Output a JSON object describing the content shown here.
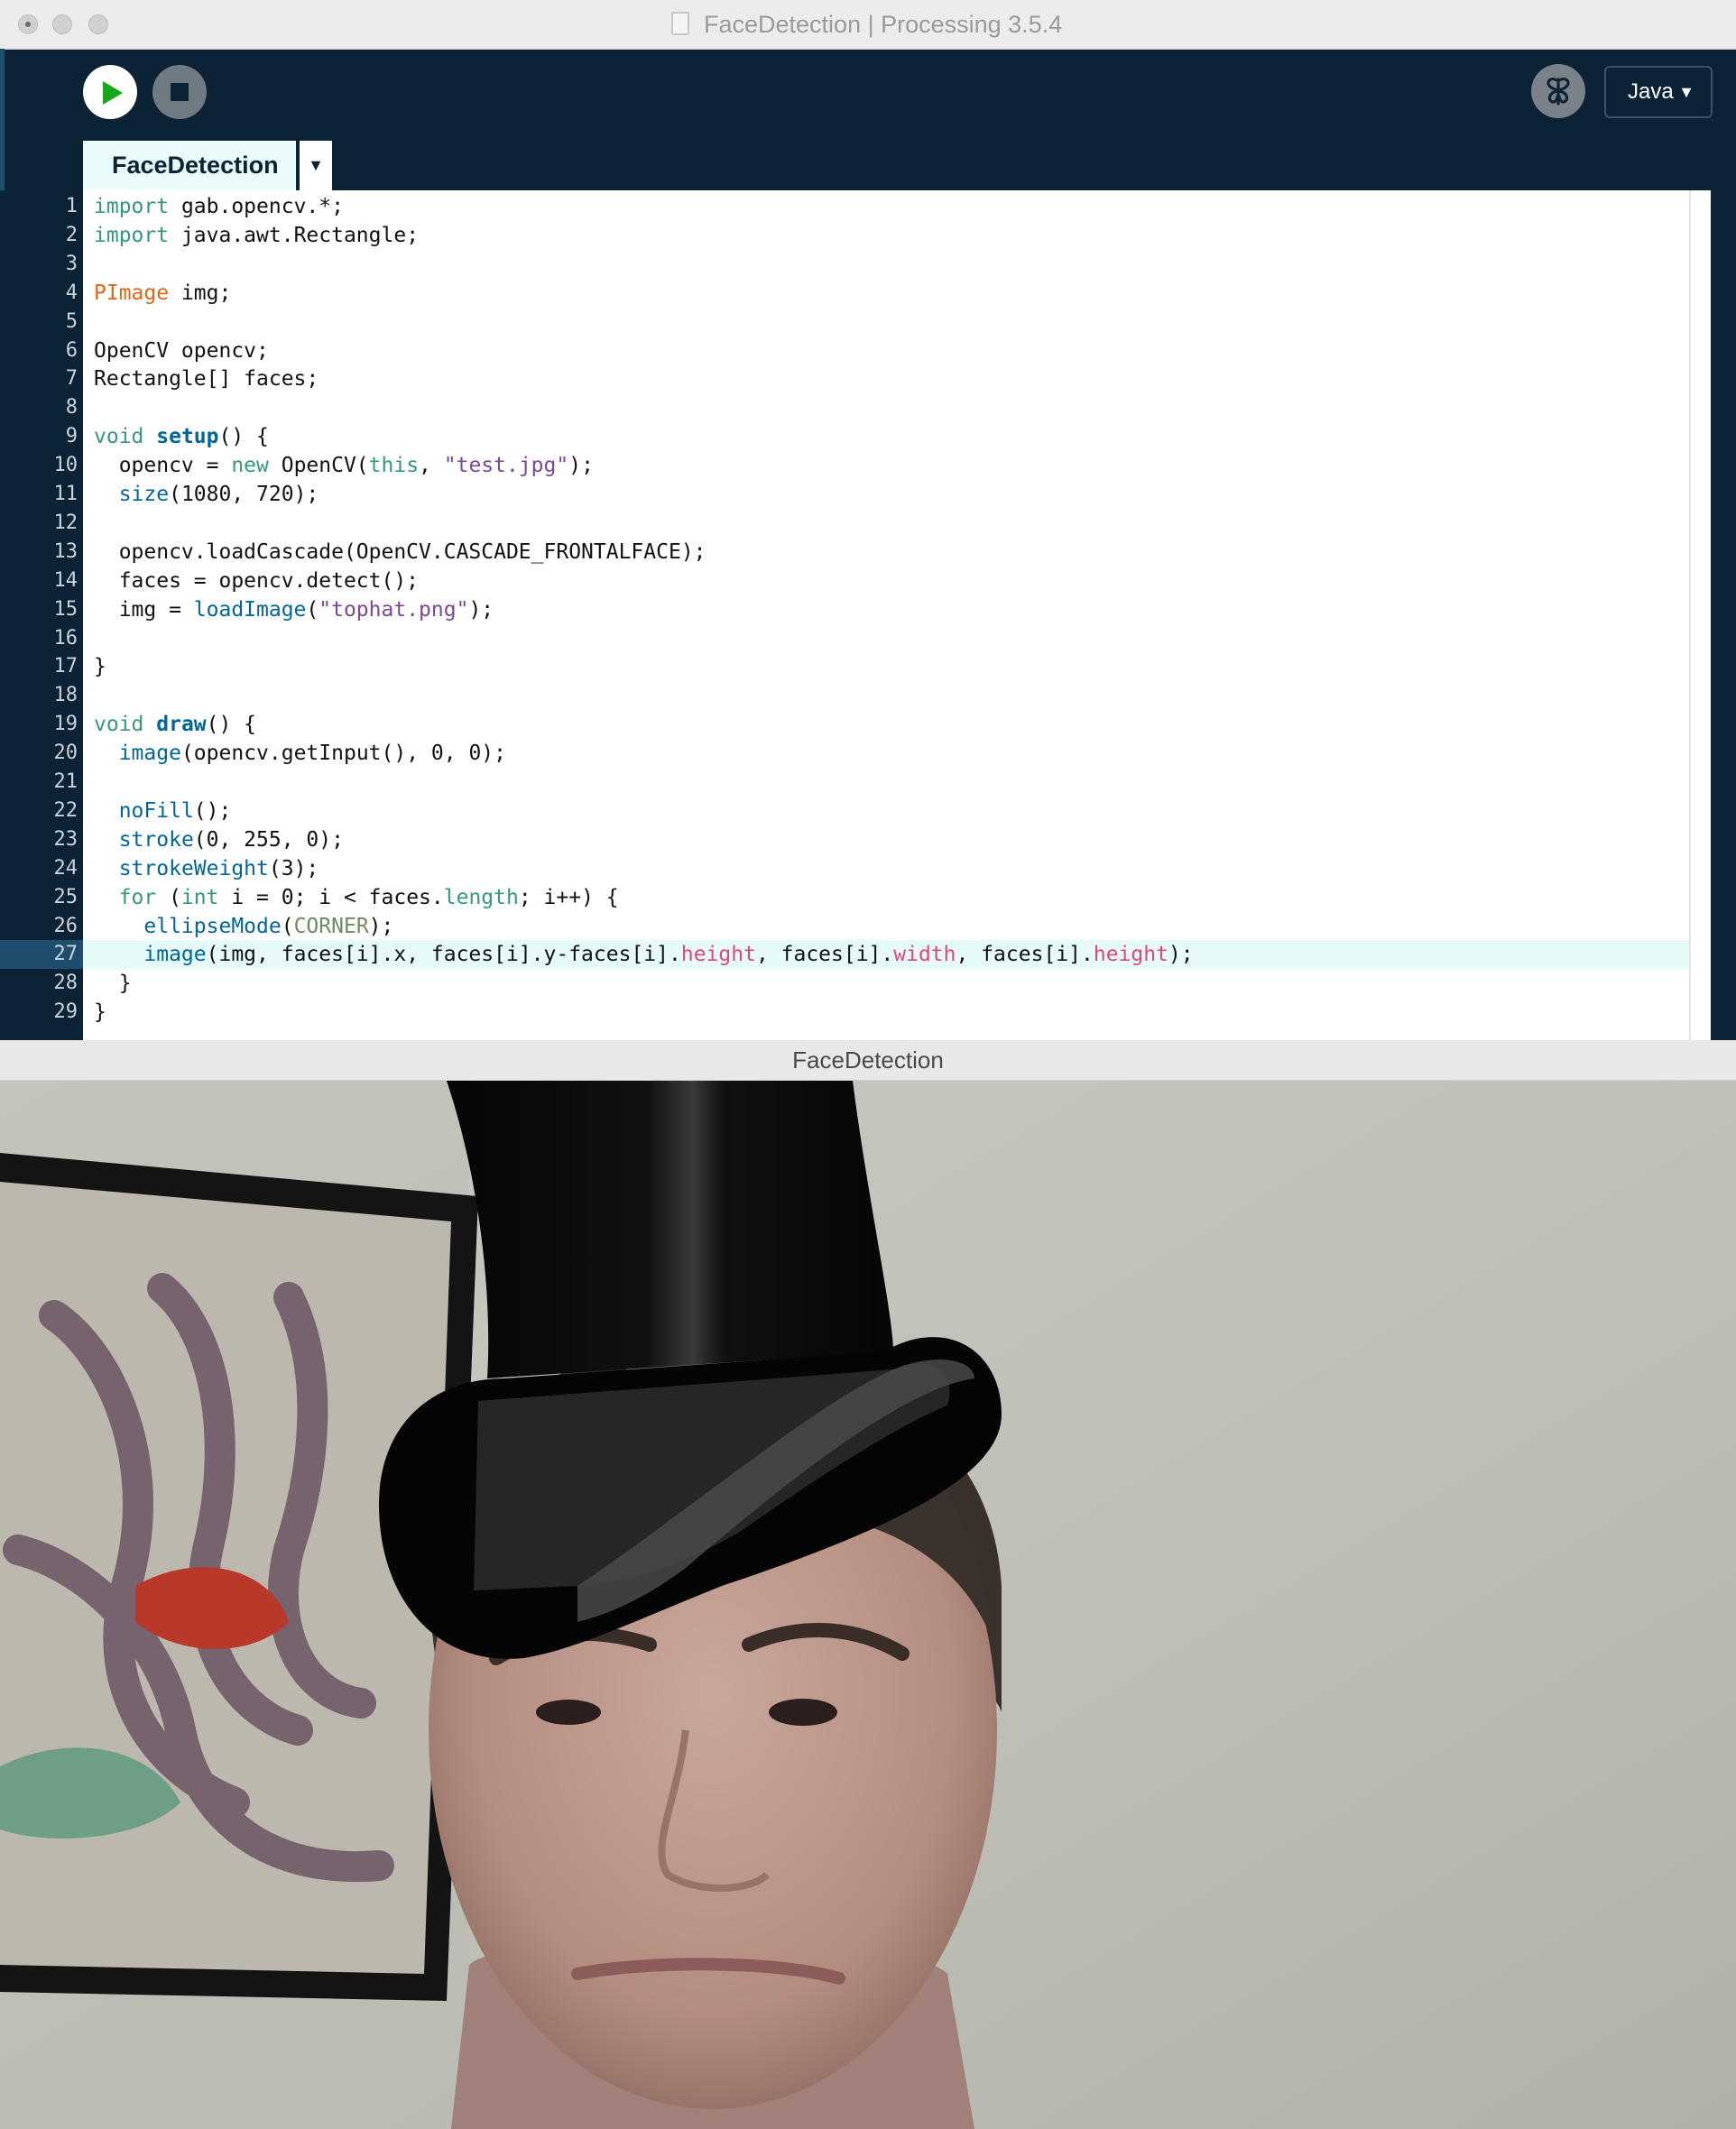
{
  "window": {
    "title": "FaceDetection | Processing 3.5.4"
  },
  "toolbar": {
    "run_icon": "play-icon",
    "stop_icon": "stop-icon",
    "debug_icon": "butterfly-icon",
    "mode_label": "Java",
    "mode_caret": "▼"
  },
  "tabs": [
    {
      "label": "FaceDetection"
    }
  ],
  "tab_menu_caret": "▼",
  "editor": {
    "current_line": 27,
    "line_numbers": [
      "1",
      "2",
      "3",
      "4",
      "5",
      "6",
      "7",
      "8",
      "9",
      "10",
      "11",
      "12",
      "13",
      "14",
      "15",
      "16",
      "17",
      "18",
      "19",
      "20",
      "21",
      "22",
      "23",
      "24",
      "25",
      "26",
      "27",
      "28",
      "29"
    ],
    "lines": [
      "import gab.opencv.*;",
      "import java.awt.Rectangle;",
      "",
      "PImage img;",
      "",
      "OpenCV opencv;",
      "Rectangle[] faces;",
      "",
      "void setup() {",
      "  opencv = new OpenCV(this, \"test.jpg\");",
      "  size(1080, 720);",
      "",
      "  opencv.loadCascade(OpenCV.CASCADE_FRONTALFACE);",
      "  faces = opencv.detect();",
      "  img = loadImage(\"tophat.png\");",
      "",
      "}",
      "",
      "void draw() {",
      "  image(opencv.getInput(), 0, 0);",
      "",
      "  noFill();",
      "  stroke(0, 255, 0);",
      "  strokeWeight(3);",
      "  for (int i = 0; i < faces.length; i++) {",
      "    ellipseMode(CORNER);",
      "    image(img, faces[i].x, faces[i].y-faces[i].height, faces[i].width, faces[i].height);",
      "  }",
      "}"
    ]
  },
  "sketch_window": {
    "title": "FaceDetection"
  },
  "colors": {
    "ide_background": "#0c2336",
    "tab_background": "#e9fbfb",
    "current_line_highlight": "#e6fafa",
    "keyword": "#33997e",
    "type": "#e2661a",
    "function": "#006699",
    "string": "#7d4793",
    "field": "#d94a7a",
    "constant": "#718a62"
  }
}
